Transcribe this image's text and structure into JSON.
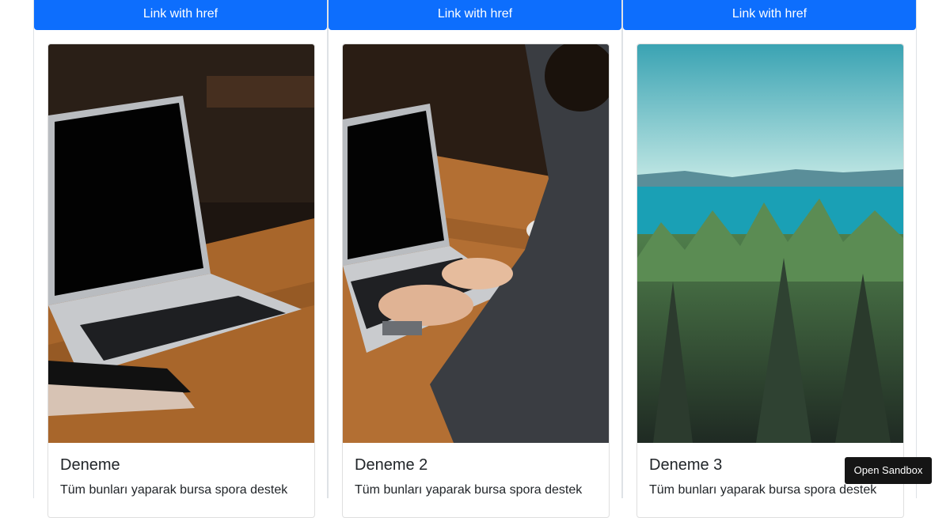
{
  "cards": [
    {
      "link_label": "Link with href",
      "title": "Deneme",
      "text": "Tüm bunları yaparak bursa spora destek"
    },
    {
      "link_label": "Link with href",
      "title": "Deneme 2",
      "text": "Tüm bunları yaparak bursa spora destek"
    },
    {
      "link_label": "Link with href",
      "title": "Deneme 3",
      "text": "Tüm bunları yaparak bursa spora destek"
    }
  ],
  "sandbox": {
    "label": "Open Sandbox"
  },
  "colors": {
    "primary": "#0d6efd",
    "sandbox_bg": "#151515"
  }
}
